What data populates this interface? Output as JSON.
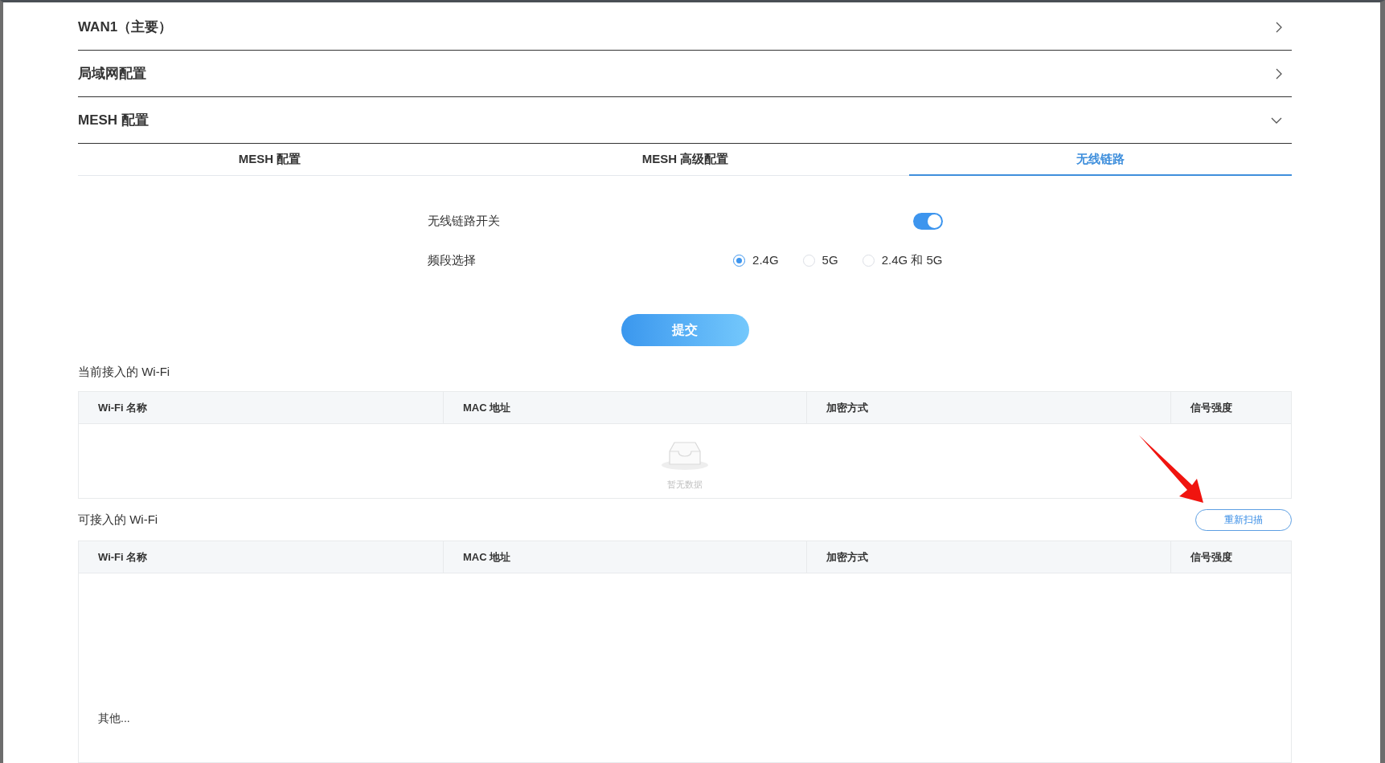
{
  "accordion": [
    {
      "title": "WAN1（主要）",
      "expanded": false
    },
    {
      "title": "局域网配置",
      "expanded": false
    },
    {
      "title": "MESH 配置",
      "expanded": true
    }
  ],
  "tabs": [
    {
      "label": "MESH 配置",
      "selected": false
    },
    {
      "label": "MESH 高级配置",
      "selected": false
    },
    {
      "label": "无线链路",
      "selected": true
    }
  ],
  "wireless_switch": {
    "label": "无线链路开关",
    "on": true
  },
  "band": {
    "label": "频段选择",
    "options": [
      {
        "label": "2.4G",
        "selected": true
      },
      {
        "label": "5G",
        "selected": false
      },
      {
        "label": "2.4G 和 5G",
        "selected": false
      }
    ]
  },
  "submit_button": "提交",
  "current_wifi": {
    "title": "当前接入的 Wi-Fi",
    "columns": [
      "Wi-Fi 名称",
      "MAC 地址",
      "加密方式",
      "信号强度"
    ],
    "empty_text": "暂无数据"
  },
  "available_wifi": {
    "title": "可接入的 Wi-Fi",
    "rescan_button": "重新扫描",
    "columns": [
      "Wi-Fi 名称",
      "MAC 地址",
      "加密方式",
      "信号强度"
    ],
    "other_entry": "其他..."
  }
}
